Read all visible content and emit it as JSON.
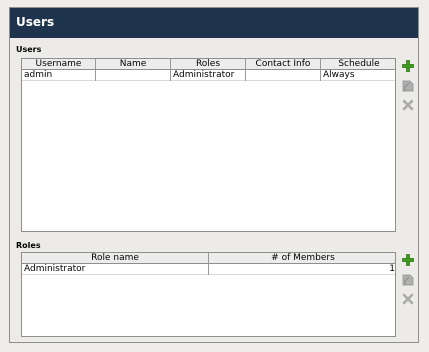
{
  "header": {
    "title": "Users"
  },
  "users_section": {
    "label": "Users",
    "columns": [
      "Username",
      "Name",
      "Roles",
      "Contact Info",
      "Schedule"
    ],
    "rows": [
      {
        "username": "admin",
        "name": "",
        "roles": "Administrator",
        "contact_info": "",
        "schedule": "Always"
      }
    ]
  },
  "roles_section": {
    "label": "Roles",
    "columns": [
      "Role name",
      "# of Members"
    ],
    "rows": [
      {
        "role_name": "Administrator",
        "members": "1"
      }
    ]
  },
  "colors": {
    "header_bg": "#1d344c",
    "add_icon": "#3d9c1d",
    "disabled_icon": "#a9a9a9"
  },
  "icons": {
    "add": "plus-icon",
    "edit": "edit-icon",
    "delete": "x-icon"
  }
}
